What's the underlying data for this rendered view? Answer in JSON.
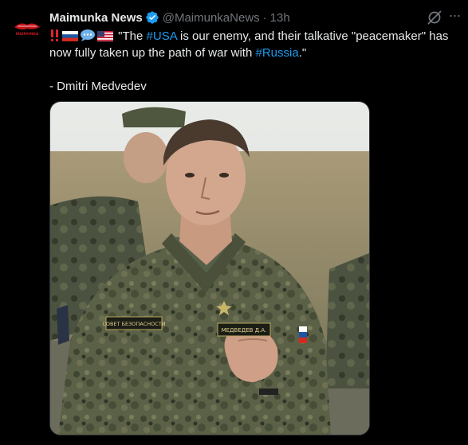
{
  "account": {
    "display_name": "Maimunka News",
    "handle": "@MaimunkaNews",
    "separator": "·",
    "timestamp": "13h",
    "avatar_label": "MAIMUNKA"
  },
  "tweet": {
    "text_main": "\"The #USA is our enemy, and their talkative \"peacemaker\" has now fully taken up the path of war with #Russia.\"",
    "hashtag_usa": "#USA",
    "hashtag_russia": "#Russia",
    "segment_1": "\"The ",
    "segment_2": " is our enemy, and their talkative \"peacemaker\" has now fully taken up the path of war with ",
    "segment_3": ".\"",
    "signature": "- Dmitri Medvedev",
    "emojis": [
      "double-exclamation-icon",
      "russia-flag-icon",
      "speech-bubble-icon",
      "usa-flag-icon"
    ]
  },
  "media": {
    "patch_left": "СОВЕТ БЕЗОПАСНОСТИ",
    "patch_right": "МЕДВЕДЕВ Д.А."
  },
  "colors": {
    "background": "#000000",
    "text": "#e7e9ea",
    "muted": "#71767b",
    "link": "#1d9bf0",
    "verified": "#1d9bf0"
  }
}
